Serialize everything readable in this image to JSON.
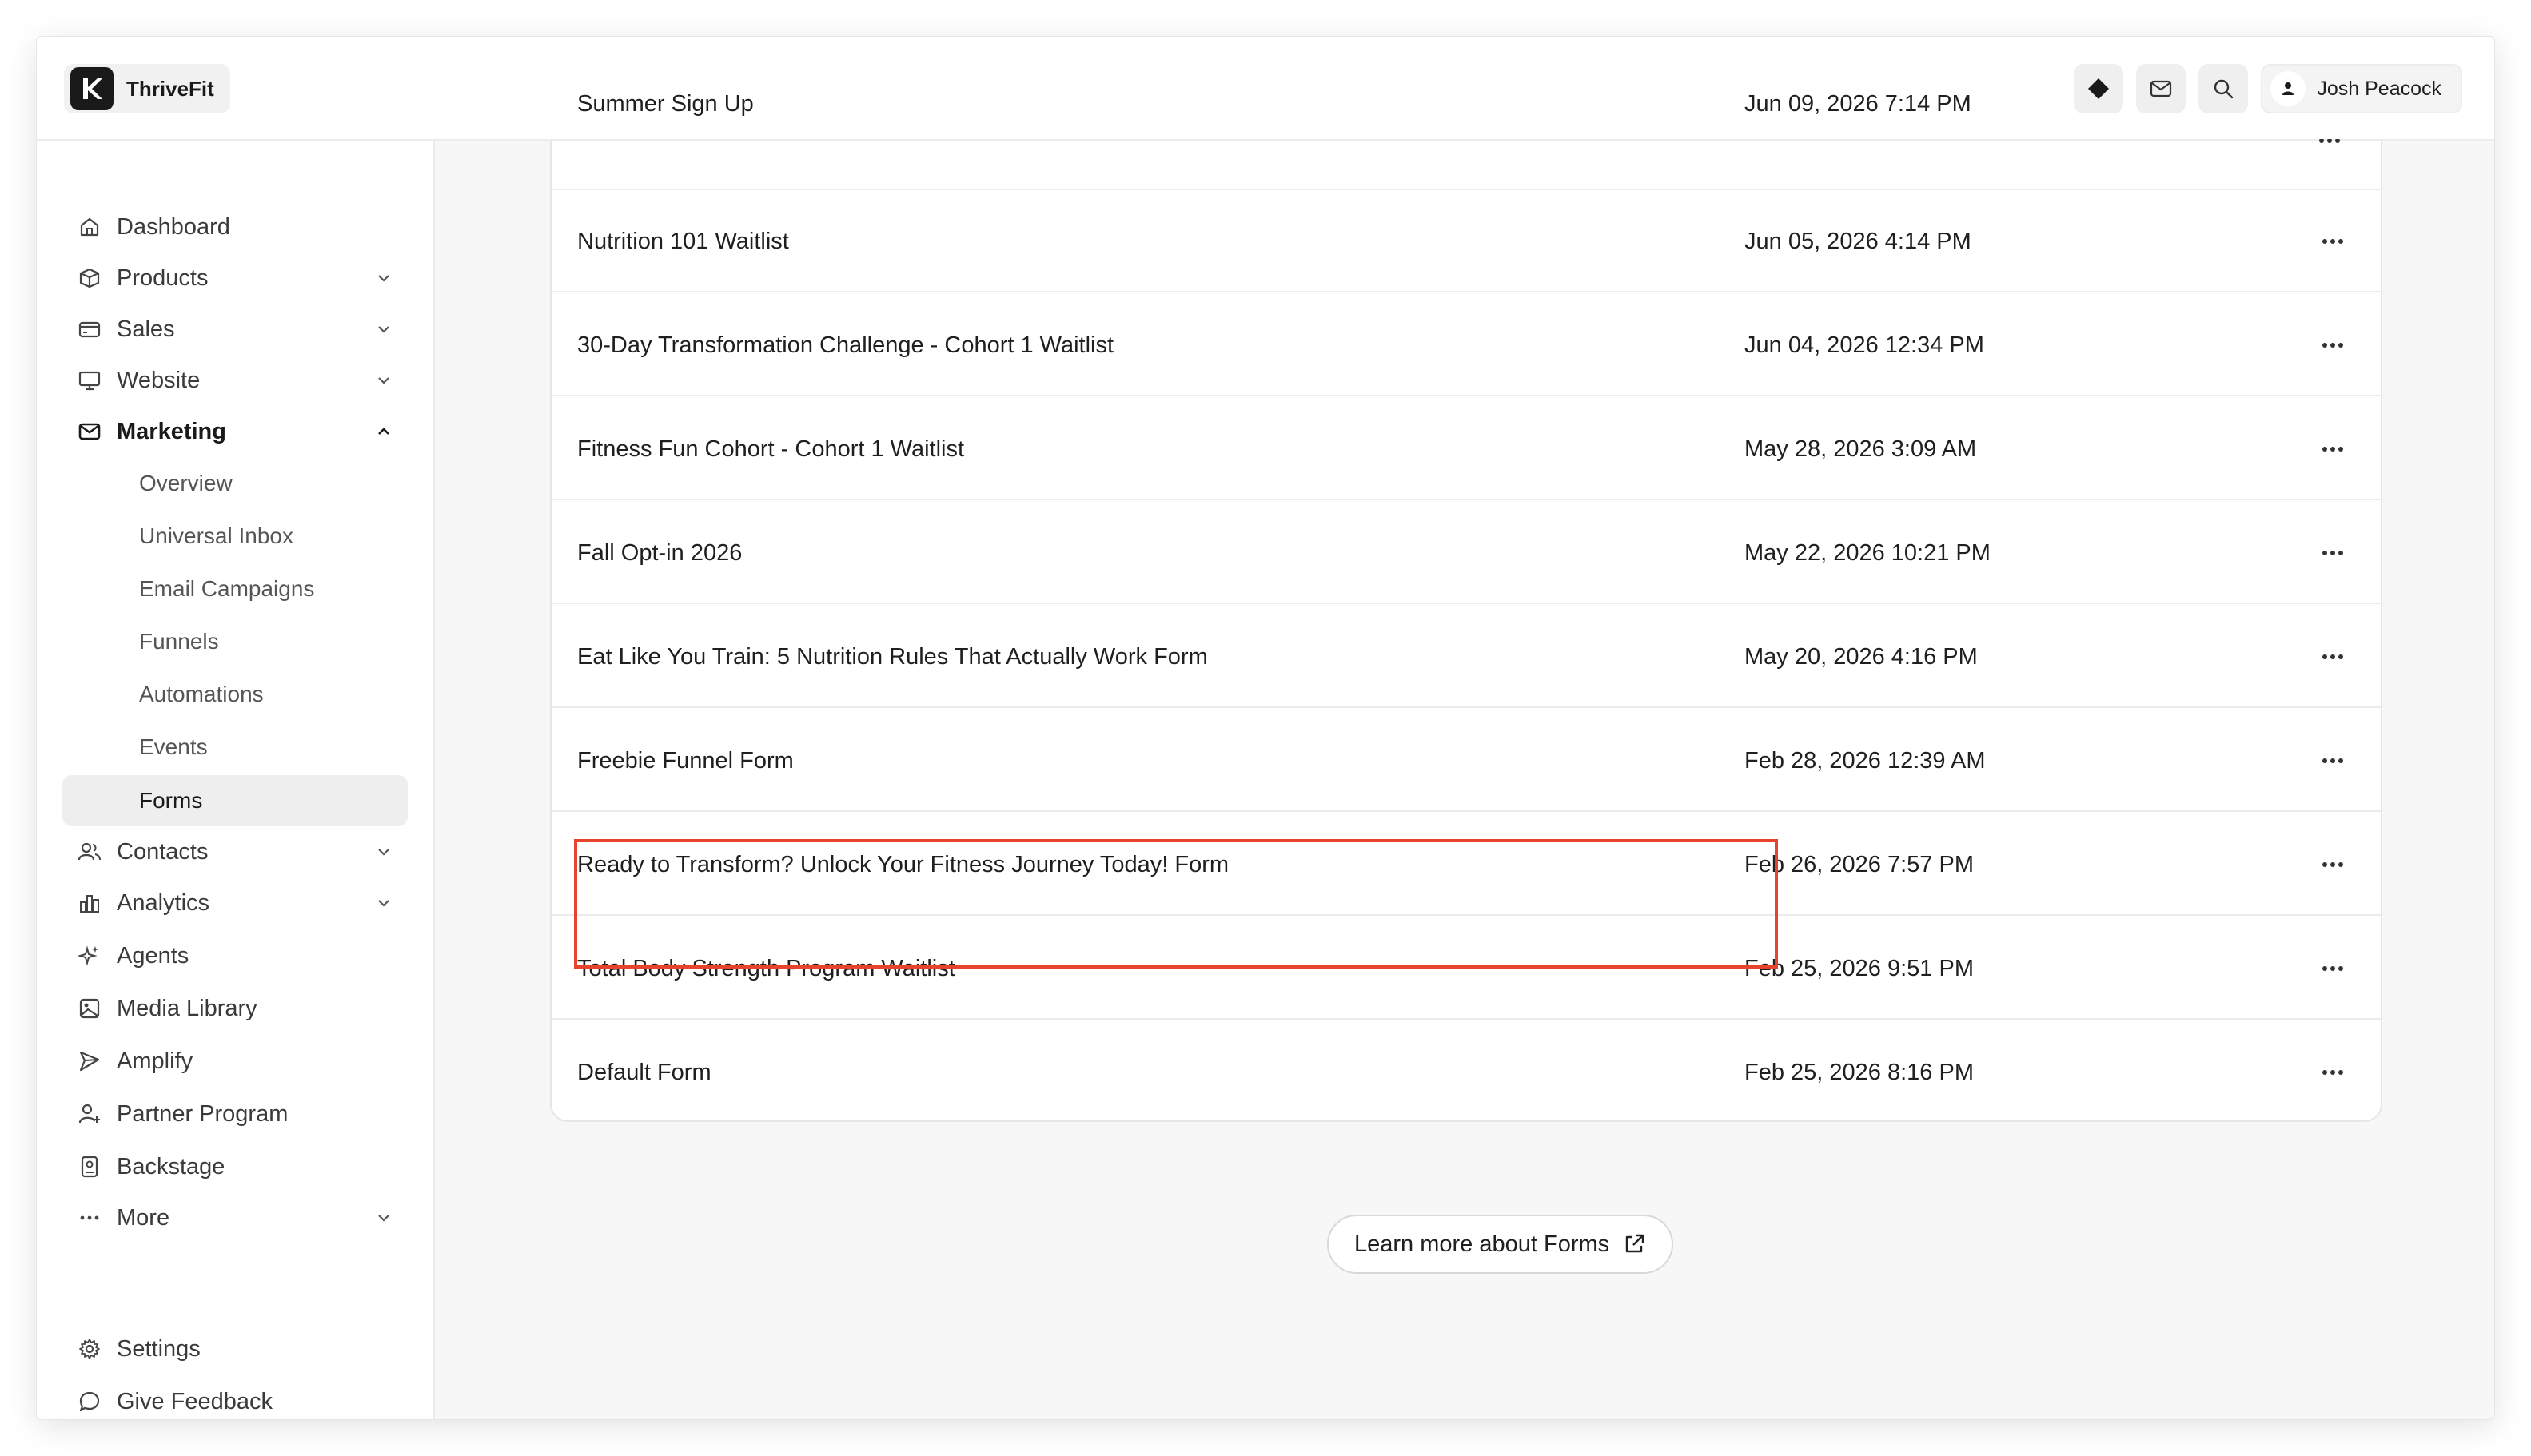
{
  "app": {
    "name": "ThriveFit"
  },
  "header": {
    "user_name": "Josh Peacock"
  },
  "sidebar": {
    "items": [
      {
        "label": "Dashboard"
      },
      {
        "label": "Products"
      },
      {
        "label": "Sales"
      },
      {
        "label": "Website"
      },
      {
        "label": "Marketing"
      },
      {
        "label": "Contacts"
      },
      {
        "label": "Analytics"
      },
      {
        "label": "Agents"
      },
      {
        "label": "Media Library"
      },
      {
        "label": "Amplify"
      },
      {
        "label": "Partner Program"
      },
      {
        "label": "Backstage"
      },
      {
        "label": "More"
      }
    ],
    "marketing_sub": [
      {
        "label": "Overview"
      },
      {
        "label": "Universal Inbox"
      },
      {
        "label": "Email Campaigns"
      },
      {
        "label": "Funnels"
      },
      {
        "label": "Automations"
      },
      {
        "label": "Events"
      },
      {
        "label": "Forms"
      }
    ],
    "bottom": [
      {
        "label": "Settings"
      },
      {
        "label": "Give Feedback"
      }
    ]
  },
  "forms": {
    "rows": [
      {
        "name": "Summer Sign Up",
        "date": "Jun 09, 2026 7:14 PM"
      },
      {
        "name": "Nutrition 101 Waitlist",
        "date": "Jun 05, 2026 4:14 PM"
      },
      {
        "name": "30-Day Transformation Challenge - Cohort 1 Waitlist",
        "date": "Jun 04, 2026 12:34 PM"
      },
      {
        "name": "Fitness Fun Cohort - Cohort 1 Waitlist",
        "date": "May 28, 2026 3:09 AM"
      },
      {
        "name": "Fall Opt-in 2026",
        "date": "May 22, 2026 10:21 PM"
      },
      {
        "name": "Eat Like You Train: 5 Nutrition Rules That Actually Work Form",
        "date": "May 20, 2026 4:16 PM"
      },
      {
        "name": "Freebie Funnel Form",
        "date": "Feb 28, 2026 12:39 AM"
      },
      {
        "name": "Ready to Transform? Unlock Your Fitness Journey Today! Form",
        "date": "Feb 26, 2026 7:57 PM"
      },
      {
        "name": "Total Body Strength Program Waitlist",
        "date": "Feb 25, 2026 9:51 PM"
      },
      {
        "name": "Default Form",
        "date": "Feb 25, 2026 8:16 PM"
      }
    ]
  },
  "learn_more": {
    "label": "Learn more about Forms"
  },
  "colors": {
    "highlight": "#e8432c"
  }
}
